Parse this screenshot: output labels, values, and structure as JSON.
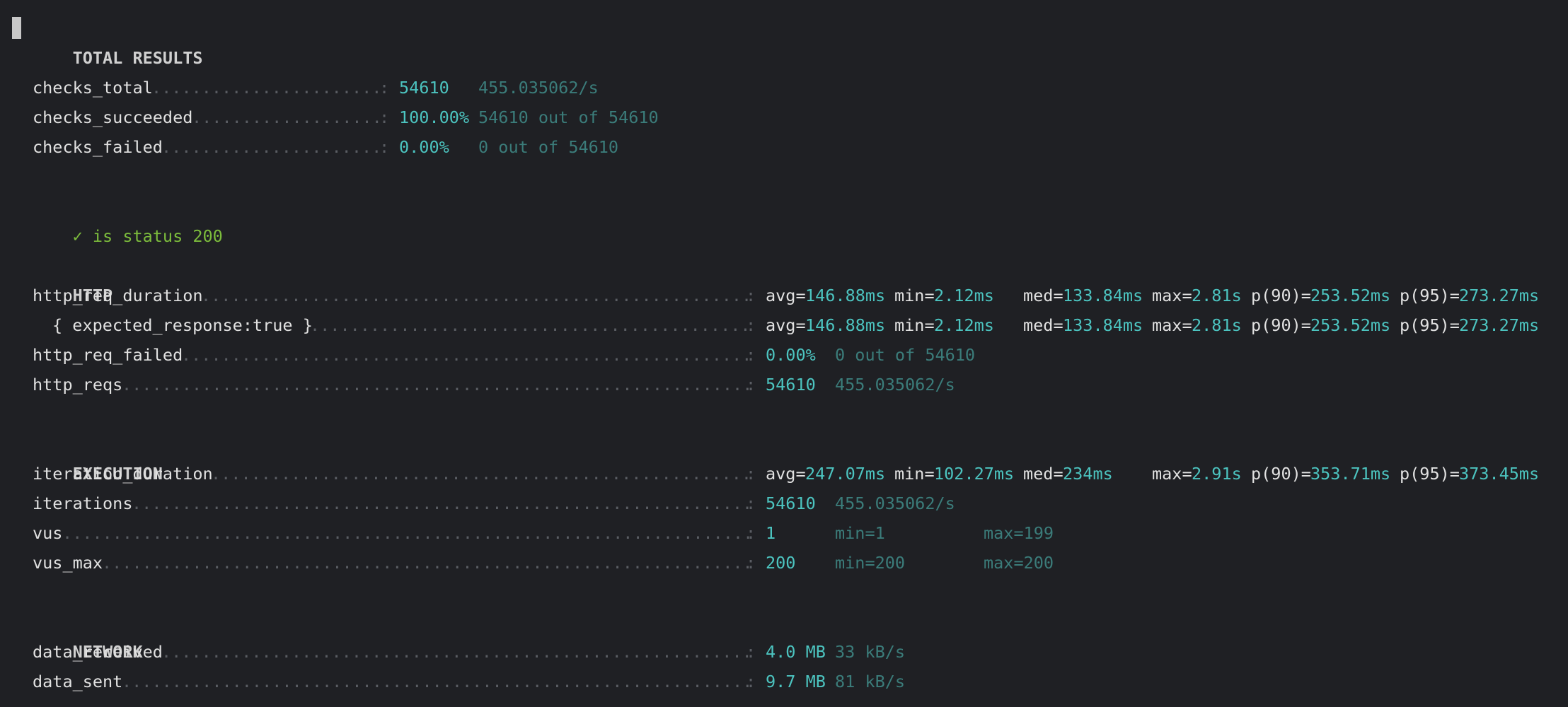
{
  "title": "TOTAL RESULTS",
  "checks": [
    {
      "name": "checks_total",
      "value": "54610",
      "extra": "455.035062/s"
    },
    {
      "name": "checks_succeeded",
      "value": "100.00%",
      "extra": "54610 out of 54610"
    },
    {
      "name": "checks_failed",
      "value": "0.00%",
      "extra": "0 out of 54610"
    }
  ],
  "check_status": "✓ is status 200",
  "sections": {
    "http": "HTTP",
    "execution": "EXECUTION",
    "network": "NETWORK"
  },
  "http_metrics": {
    "req_duration": {
      "name": "http_req_duration",
      "avg_k": "avg=",
      "avg": "146.88ms",
      "min_k": "min=",
      "min": "2.12ms",
      "med_k": "med=",
      "med": "133.84ms",
      "max_k": "max=",
      "max": "2.81s",
      "p90_k": "p(90)=",
      "p90": "253.52ms",
      "p95_k": "p(95)=",
      "p95": "273.27ms"
    },
    "expected": {
      "name": "{ expected_response:true }",
      "avg_k": "avg=",
      "avg": "146.88ms",
      "min_k": "min=",
      "min": "2.12ms",
      "med_k": "med=",
      "med": "133.84ms",
      "max_k": "max=",
      "max": "2.81s",
      "p90_k": "p(90)=",
      "p90": "253.52ms",
      "p95_k": "p(95)=",
      "p95": "273.27ms"
    },
    "req_failed": {
      "name": "http_req_failed",
      "value": "0.00%",
      "extra": "0 out of 54610"
    },
    "reqs": {
      "name": "http_reqs",
      "value": "54610",
      "extra": "455.035062/s"
    }
  },
  "execution_metrics": {
    "iteration_duration": {
      "name": "iteration_duration",
      "avg_k": "avg=",
      "avg": "247.07ms",
      "min_k": "min=",
      "min": "102.27ms",
      "med_k": "med=",
      "med": "234ms",
      "max_k": "max=",
      "max": "2.91s",
      "p90_k": "p(90)=",
      "p90": "353.71ms",
      "p95_k": "p(95)=",
      "p95": "373.45ms"
    },
    "iterations": {
      "name": "iterations",
      "value": "54610",
      "extra": "455.035062/s"
    },
    "vus": {
      "name": "vus",
      "value": "1",
      "min": "min=1",
      "max": "max=199"
    },
    "vus_max": {
      "name": "vus_max",
      "value": "200",
      "min": "min=200",
      "max": "max=200"
    }
  },
  "network_metrics": {
    "data_received": {
      "name": "data_received",
      "value": "4.0 MB",
      "extra": "33 kB/s"
    },
    "data_sent": {
      "name": "data_sent",
      "value": "9.7 MB",
      "extra": "81 kB/s"
    }
  },
  "colors": {
    "background": "#1f2024",
    "value": "#4cc4c0",
    "secondary": "#3b7c7a",
    "success": "#7cbc3c"
  }
}
